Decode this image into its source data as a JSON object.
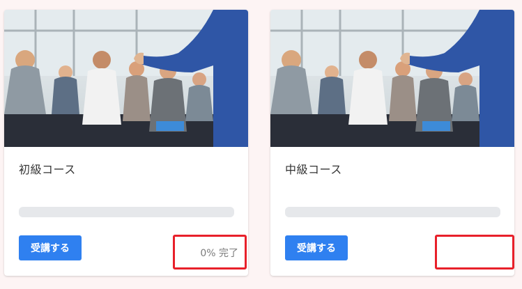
{
  "courses": [
    {
      "title": "初級コース",
      "enroll_label": "受講する",
      "progress_percent": 0,
      "completion_text": "0% 完了",
      "image_icon": "seminar-photo"
    },
    {
      "title": "中級コース",
      "enroll_label": "受講する",
      "progress_percent": 0,
      "completion_text": "",
      "image_icon": "seminar-photo"
    }
  ],
  "colors": {
    "accent": "#2f80f0",
    "highlight": "#e8202a",
    "background": "#fdf4f4",
    "progress_track": "#e6e8eb"
  }
}
